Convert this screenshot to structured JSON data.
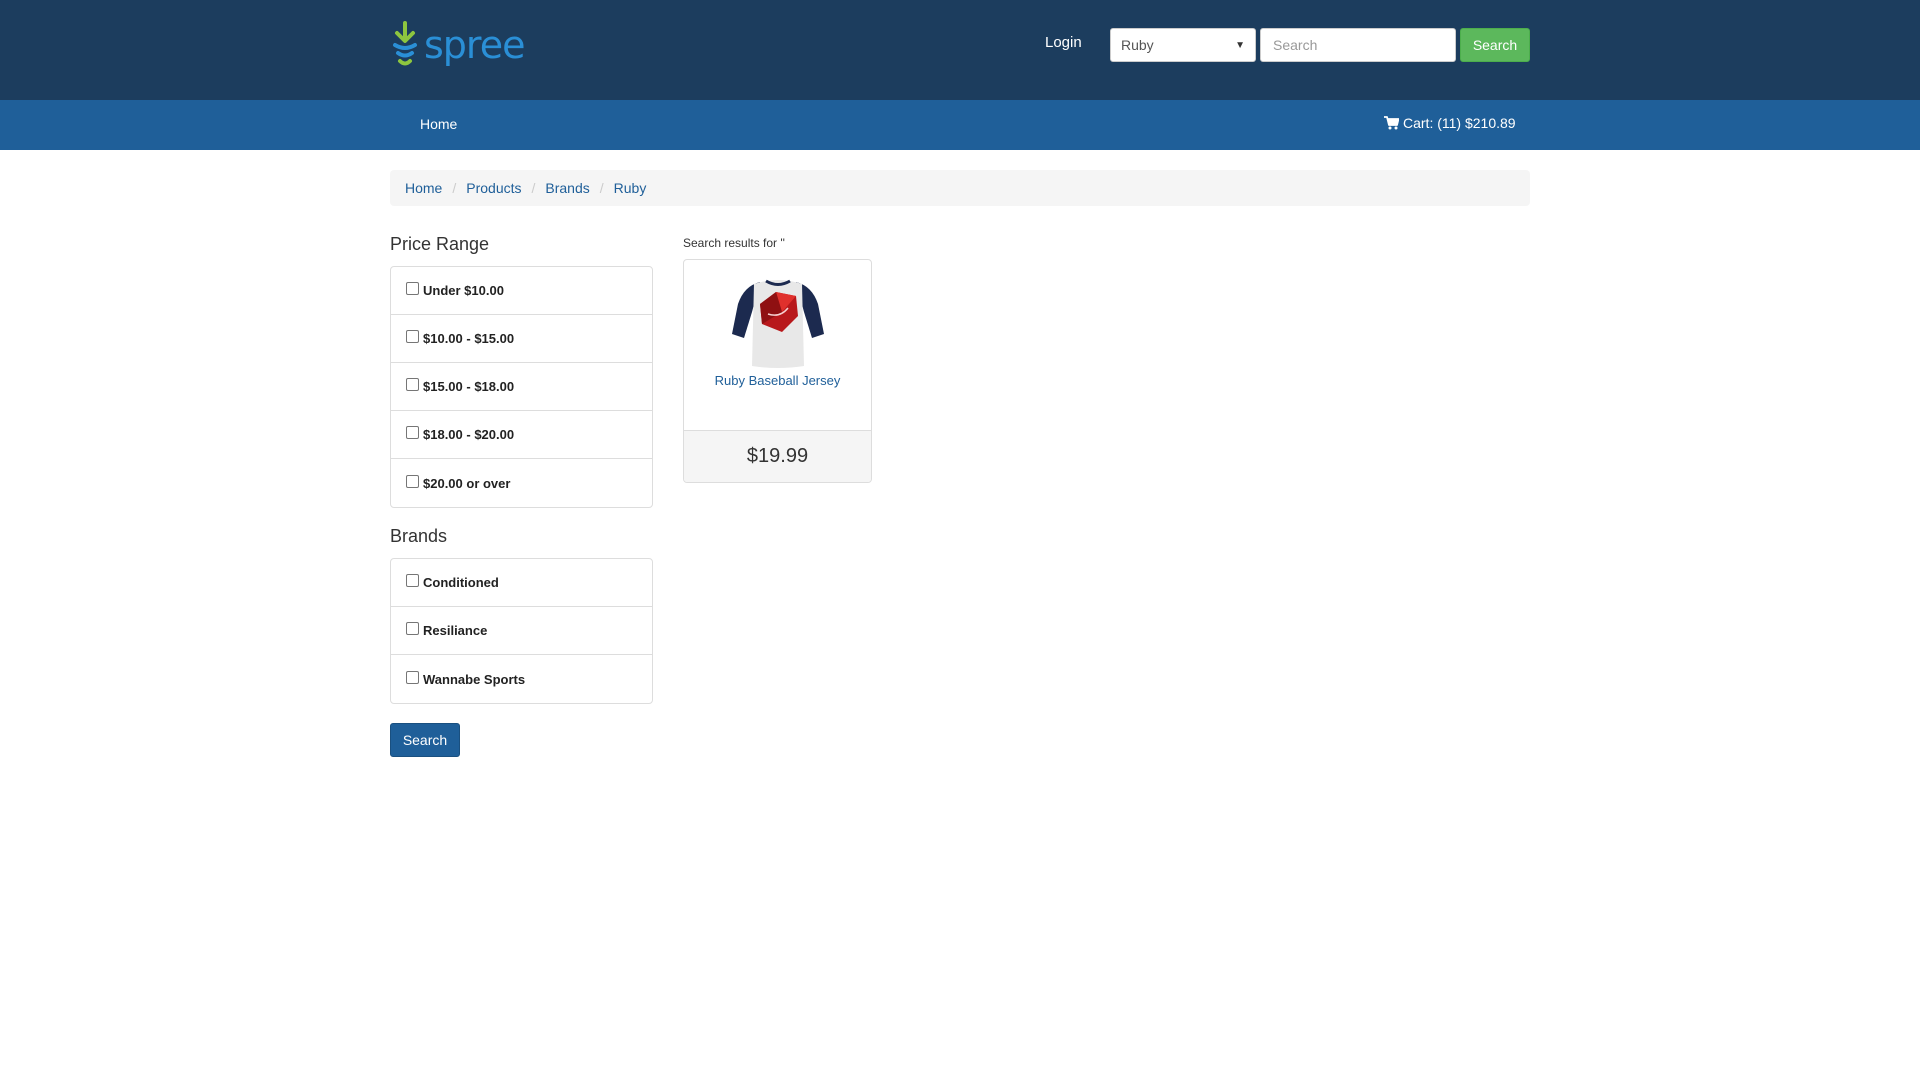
{
  "header": {
    "logo_text": "spree",
    "login_label": "Login",
    "taxon_selected": "Ruby",
    "search_placeholder": "Search",
    "search_button": "Search"
  },
  "navbar": {
    "home_label": "Home",
    "cart_label": "Cart: (11) $210.89"
  },
  "breadcrumb": [
    "Home",
    "Products",
    "Brands",
    "Ruby"
  ],
  "sidebar": {
    "price_title": "Price Range",
    "price_options": [
      "Under $10.00",
      "$10.00 - $15.00",
      "$15.00 - $18.00",
      "$18.00 - $20.00",
      "$20.00 or over"
    ],
    "brands_title": "Brands",
    "brand_options": [
      "Conditioned",
      "Resiliance",
      "Wannabe Sports"
    ],
    "search_button": "Search"
  },
  "results": {
    "label": "Search results for ''",
    "products": [
      {
        "name": "Ruby Baseball Jersey",
        "price": "$19.99"
      }
    ]
  },
  "colors": {
    "header_bg": "#1c3d5e",
    "navbar_bg": "#1f5f99",
    "accent_green": "#5cb85c",
    "link_blue": "#1f5f99"
  }
}
